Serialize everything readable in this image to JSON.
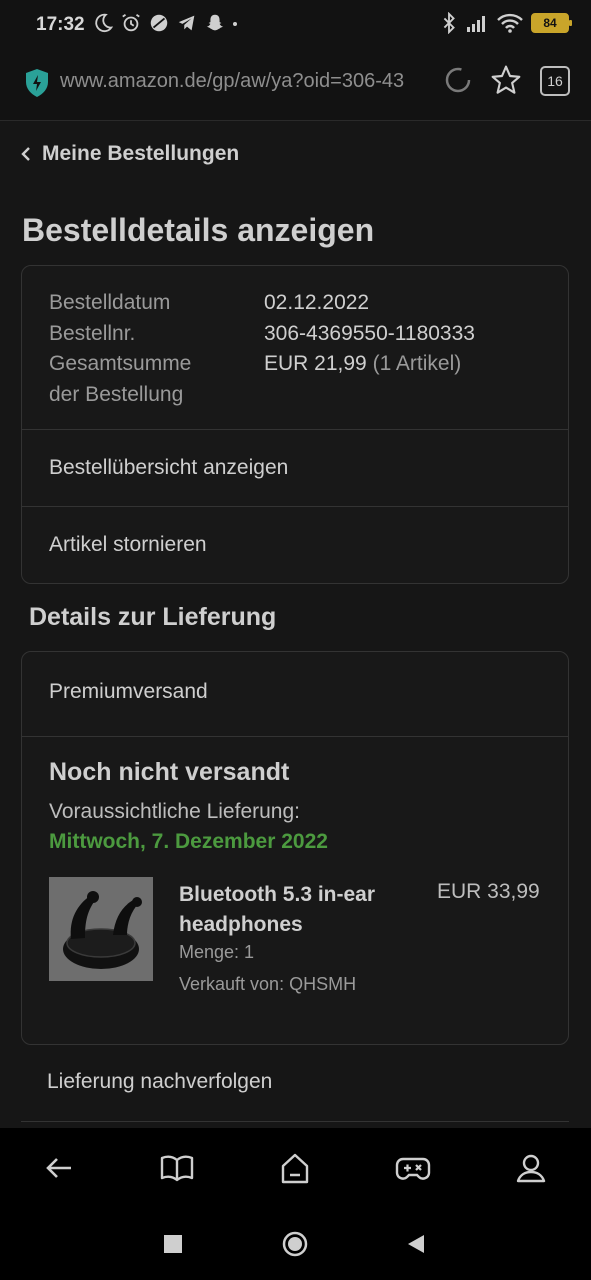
{
  "status_bar": {
    "time": "17:32",
    "battery": "84"
  },
  "browser": {
    "url": "www.amazon.de/gp/aw/ya?oid=306-43",
    "tab_count": "16"
  },
  "nav": {
    "back_label": "Meine Bestellungen"
  },
  "page": {
    "title": "Bestelldetails anzeigen"
  },
  "order": {
    "date_label": "Bestelldatum",
    "date_value": "02.12.2022",
    "number_label": "Bestellnr.",
    "number_value": "306-4369550-1180333",
    "total_label_line1": "Gesamtsumme",
    "total_label_line2": "der Bestellung",
    "total_value": "EUR 21,99",
    "total_items": "(1 Artikel)",
    "summary_link": "Bestellübersicht anzeigen",
    "cancel_link": "Artikel stornieren"
  },
  "delivery": {
    "section_title": "Details zur Lieferung",
    "shipping_method": "Premiumversand",
    "status": "Noch nicht versandt",
    "eta_label": "Voraussichtliche Lieferung:",
    "eta_date": "Mittwoch, 7. Dezember 2022",
    "eta_color": "#4c9a3f",
    "product": {
      "title": "Bluetooth 5.3 in-ear headphones",
      "price": "EUR 33,99",
      "quantity": "Menge: 1",
      "seller": "Verkauft von: QHSMH"
    },
    "track_link": "Lieferung nachverfolgen"
  }
}
